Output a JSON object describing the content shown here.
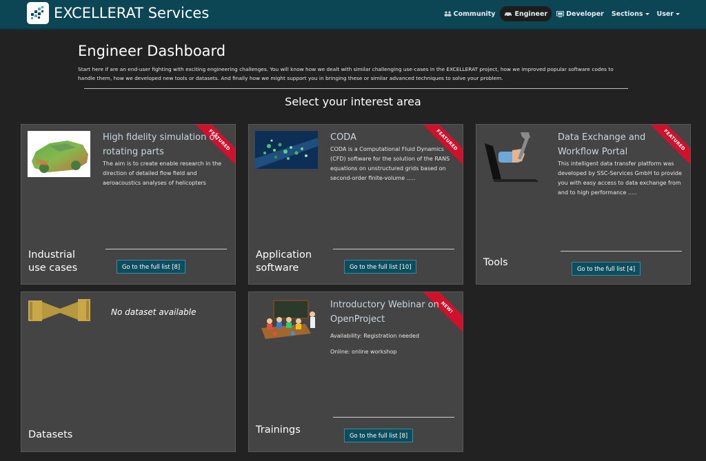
{
  "brand": {
    "name": "EXCELLERAT Services",
    "logo_icon": "dots-logo-icon"
  },
  "nav": {
    "items": [
      {
        "label": "Community",
        "icon": "community-icon",
        "active": false
      },
      {
        "label": "Engineer",
        "icon": "car-icon",
        "active": true
      },
      {
        "label": "Developer",
        "icon": "monitor-icon",
        "active": false
      },
      {
        "label": "Sections",
        "dropdown": true
      },
      {
        "label": "User",
        "dropdown": true
      }
    ]
  },
  "page": {
    "title": "Engineer Dashboard",
    "intro": "Start here if are an end-user fighting with exciting engineering challenges. You will know how we dealt with similar challenging use-cases in the EXCELLERAT project, how we improved popular software codes to handle them, how we developed new tools or datasets. And finally how we might support you in bringing these or similar advanced techniques to solve your problem.",
    "subtitle": "Select your interest area"
  },
  "cards": [
    {
      "category": "Industrial use cases",
      "title": "High fidelity simulation of rotating parts",
      "description": "The aim is to create enable research in the direction of detailed flow field and aeroacoustics analyses of helicopters",
      "button": "Go to the full list [8]",
      "ribbon": "FEATURED",
      "thumb_icon": "car-simulation-image"
    },
    {
      "category": "Application software",
      "title": "CODA",
      "description": "CODA is a Computational Fluid Dynamics (CFD) software for the solution of the RANS equations on unstructured grids based on second-order finite-volume .....",
      "button": "Go to the full list [10]",
      "ribbon": "FEATURED",
      "thumb_icon": "cfd-flow-image"
    },
    {
      "category": "Tools",
      "title": "Data Exchange and Workflow Portal",
      "description": "This intelligent data transfer platform was developed by SSC-Services GmbH to provide you with easy access to data exchange from and to high performance .....",
      "button": "Go to the full list [4]",
      "ribbon": "FEATURED",
      "thumb_icon": "laptop-wrench-image"
    },
    {
      "category": "Datasets",
      "empty_text": "No dataset available",
      "thumb_icon": "data-funnel-image"
    },
    {
      "category": "Trainings",
      "title": "Introductory Webinar on OpenProject",
      "availability": "Availability: Registration needed",
      "online": "Online: online workshop",
      "button": "Go to the full list [8]",
      "ribbon": "NEW!",
      "thumb_icon": "classroom-image"
    }
  ],
  "colors": {
    "navbar": "#0c4554",
    "ribbon": "#d0112b",
    "button": "#0c4e5e",
    "card": "#444444",
    "background": "#222222"
  }
}
